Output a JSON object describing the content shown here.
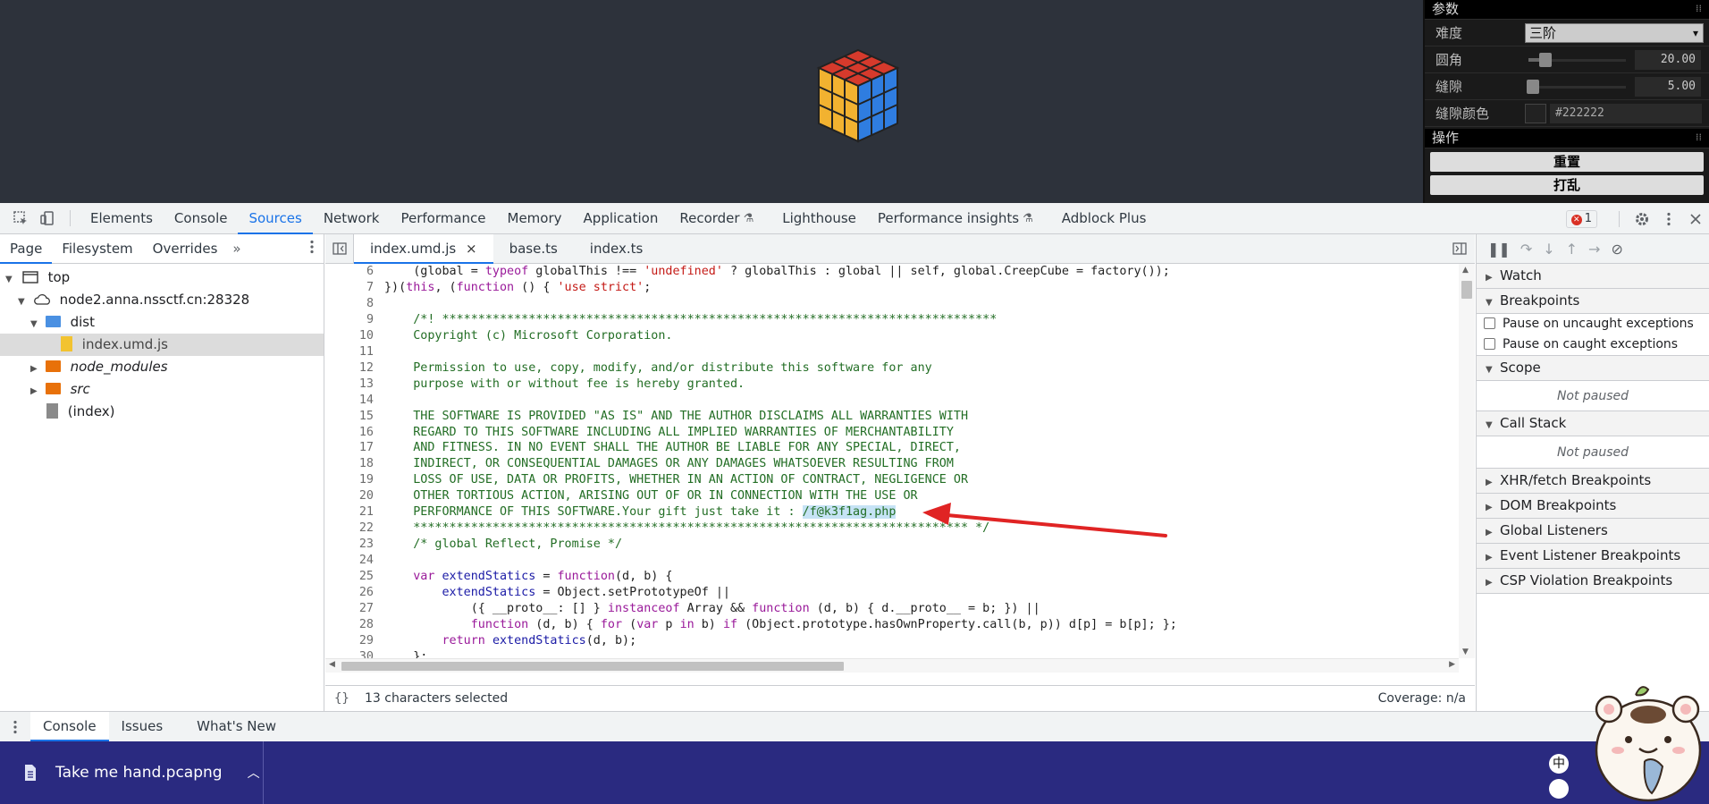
{
  "gui": {
    "section_params": "参数",
    "collapse_glyph": "⁞⁞",
    "difficulty_label": "难度",
    "difficulty_value": "三阶",
    "radius_label": "圆角",
    "radius_value": "20.00",
    "radius_fraction": 0.17,
    "gap_label": "缝隙",
    "gap_value": "5.00",
    "gap_fraction": 0.05,
    "gap_color_label": "缝隙颜色",
    "gap_color_value": "#222222",
    "section_ops": "操作",
    "reset_button": "重置",
    "shuffle_button": "打乱"
  },
  "devtools_tabs": [
    "Elements",
    "Console",
    "Sources",
    "Network",
    "Performance",
    "Memory",
    "Application",
    "Recorder",
    "Lighthouse",
    "Performance insights",
    "Adblock Plus"
  ],
  "devtools_active_tab": "Sources",
  "error_count": "1",
  "navigator": {
    "tabs": [
      "Page",
      "Filesystem",
      "Overrides"
    ],
    "tree": [
      {
        "label": "top",
        "level": 0,
        "icon": "frame-icon"
      },
      {
        "label": "node2.anna.nssctf.cn:28328",
        "level": 1,
        "icon": "cloud-icon"
      },
      {
        "label": "dist",
        "level": 2,
        "icon": "folder-icon"
      },
      {
        "label": "index.umd.js",
        "level": 3,
        "icon": "js-file-icon"
      },
      {
        "label": "node_modules",
        "level": 2,
        "icon": "folder-icon"
      },
      {
        "label": "src",
        "level": 2,
        "icon": "folder-icon"
      },
      {
        "label": "(index)",
        "level": 2,
        "icon": "file-icon"
      }
    ]
  },
  "editor": {
    "tabs": [
      "index.umd.js",
      "base.ts",
      "index.ts"
    ],
    "close_glyph": "×",
    "line_numbers": [
      "6",
      "7",
      "8",
      "9",
      "10",
      "11",
      "12",
      "13",
      "14",
      "15",
      "16",
      "17",
      "18",
      "19",
      "20",
      "21",
      "22",
      "23",
      "24",
      "25",
      "26",
      "27",
      "28",
      "29",
      "30"
    ],
    "lines": [
      "    (global = typeof globalThis !== 'undefined' ? globalThis : global || self, global.CreepCube = factory());",
      "})(this, (function () { 'use strict';",
      "",
      "    /*! *****************************************************************************",
      "    Copyright (c) Microsoft Corporation.",
      "",
      "    Permission to use, copy, modify, and/or distribute this software for any",
      "    purpose with or without fee is hereby granted.",
      "",
      "    THE SOFTWARE IS PROVIDED \"AS IS\" AND THE AUTHOR DISCLAIMS ALL WARRANTIES WITH",
      "    REGARD TO THIS SOFTWARE INCLUDING ALL IMPLIED WARRANTIES OF MERCHANTABILITY",
      "    AND FITNESS. IN NO EVENT SHALL THE AUTHOR BE LIABLE FOR ANY SPECIAL, DIRECT,",
      "    INDIRECT, OR CONSEQUENTIAL DAMAGES OR ANY DAMAGES WHATSOEVER RESULTING FROM",
      "    LOSS OF USE, DATA OR PROFITS, WHETHER IN AN ACTION OF CONTRACT, NEGLIGENCE OR",
      "    OTHER TORTIOUS ACTION, ARISING OUT OF OR IN CONNECTION WITH THE USE OR",
      "    PERFORMANCE OF THIS SOFTWARE.Your gift just take it : /f@k3f1ag.php",
      "    ***************************************************************************** */",
      "    /* global Reflect, Promise */",
      "",
      "    var extendStatics = function(d, b) {",
      "        extendStatics = Object.setPrototypeOf ||",
      "            ({ __proto__: [] } instanceof Array && function (d, b) { d.__proto__ = b; }) ||",
      "            function (d, b) { for (var p in b) if (Object.prototype.hasOwnProperty.call(b, p)) d[p] = b[p]; };",
      "        return extendStatics(d, b);",
      "    };"
    ],
    "selected_text": "/f@k3f1ag.php",
    "status_left": "13 characters selected",
    "status_right": "Coverage: n/a",
    "format_glyph": "{}"
  },
  "debugger": {
    "sections": [
      "Watch",
      "Breakpoints",
      "Scope",
      "Call Stack",
      "XHR/fetch Breakpoints",
      "DOM Breakpoints",
      "Global Listeners",
      "Event Listener Breakpoints",
      "CSP Violation Breakpoints"
    ],
    "pause_uncaught": "Pause on uncaught exceptions",
    "pause_caught": "Pause on caught exceptions",
    "not_paused": "Not paused"
  },
  "drawer": {
    "tabs": [
      "Console",
      "Issues",
      "What's New"
    ]
  },
  "download": {
    "filename": "Take me hand.pcapng",
    "ime_glyph": "中"
  },
  "colors": {
    "accent": "#1a73e8",
    "annotation_arrow": "#e02424",
    "download_bar": "#2a2a80"
  }
}
